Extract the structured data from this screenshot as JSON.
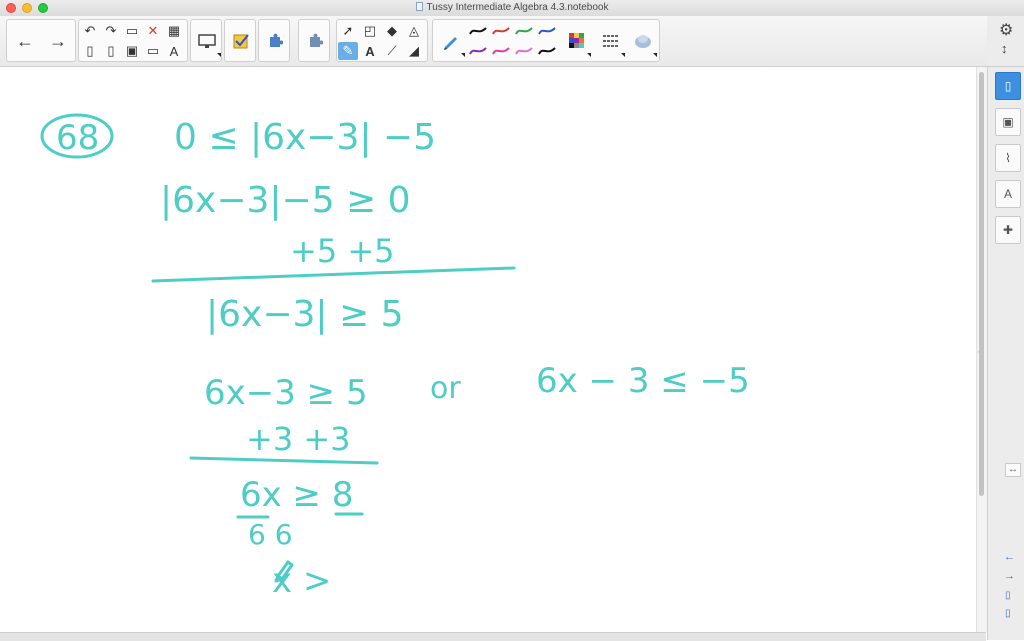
{
  "window": {
    "title": "Tussy Intermediate Algebra 4.3.notebook"
  },
  "colors": {
    "ink": "#4ecdc4",
    "accent": "#3d8fe0"
  },
  "toolbar": {
    "nav": [
      {
        "icon": "arrow-left-icon",
        "glyph": "←"
      },
      {
        "icon": "arrow-right-icon",
        "glyph": "→"
      }
    ],
    "edit": [
      {
        "icon": "undo-icon",
        "glyph": "↶"
      },
      {
        "icon": "redo-icon",
        "glyph": "↷"
      },
      {
        "icon": "paste-icon",
        "glyph": "▭"
      },
      {
        "icon": "delete-icon",
        "glyph": "✕"
      },
      {
        "icon": "table-icon",
        "glyph": "▦"
      },
      {
        "icon": "new-page-icon",
        "glyph": "▯"
      },
      {
        "icon": "clear-page-icon",
        "glyph": "▯"
      },
      {
        "icon": "save-icon",
        "glyph": "▣"
      },
      {
        "icon": "screen-shade-icon",
        "glyph": "▭"
      },
      {
        "icon": "text-format-icon",
        "glyph": "A"
      }
    ],
    "tools": [
      {
        "icon": "select-arrow-icon",
        "glyph": "➚"
      },
      {
        "icon": "shapes-icon",
        "glyph": "◰"
      },
      {
        "icon": "eraser-icon",
        "glyph": "◆"
      },
      {
        "icon": "fill-icon",
        "glyph": "◬"
      },
      {
        "icon": "pens-icon",
        "glyph": "✎"
      },
      {
        "icon": "text-icon",
        "glyph": "A"
      },
      {
        "icon": "line-icon",
        "glyph": "⟋"
      },
      {
        "icon": "eraser-pen-icon",
        "glyph": "◢"
      }
    ],
    "pen_colors": [
      "#111111",
      "#d23b2f",
      "#2ba84a",
      "#2c56c8",
      "#8b2ab8",
      "#e23aa8",
      "#e070d0",
      "#111111"
    ]
  },
  "sidebar": {
    "tabs": [
      {
        "icon": "page-sorter-icon",
        "glyph": "▯",
        "selected": true
      },
      {
        "icon": "gallery-icon",
        "glyph": "▣",
        "selected": false
      },
      {
        "icon": "attachments-icon",
        "glyph": "⌇",
        "selected": false
      },
      {
        "icon": "properties-icon",
        "glyph": "A",
        "selected": false
      },
      {
        "icon": "addons-icon",
        "glyph": "✚",
        "selected": false
      }
    ]
  },
  "handwriting": {
    "problem_number": "68",
    "lines": [
      "0 ≤ |6x−3| −5",
      "|6x−3|−5 ≥ 0",
      "+5   +5",
      "|6x−3| ≥ 5",
      "6x−3 ≥ 5",
      "or",
      "6x − 3 ≤ −5",
      "+3   +3",
      "6x ≥ 8",
      "6      6",
      "x >"
    ]
  }
}
